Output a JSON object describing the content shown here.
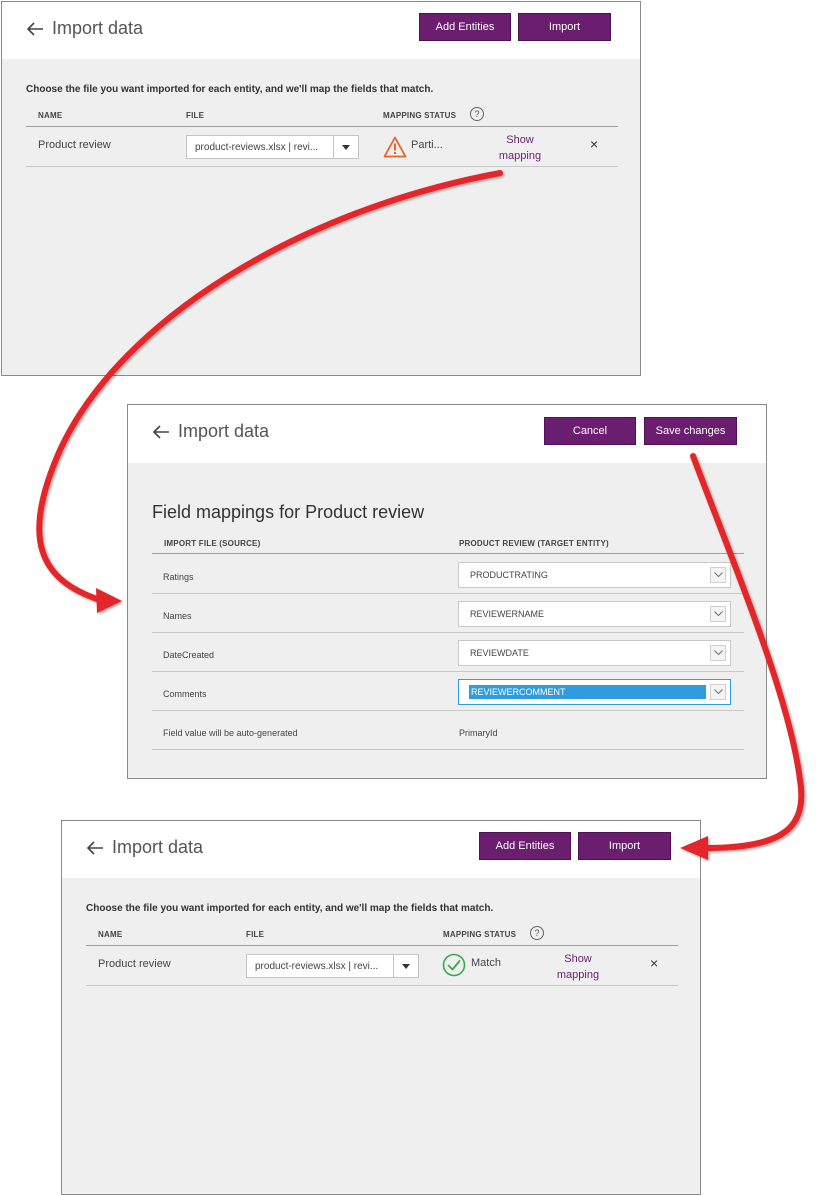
{
  "panel1": {
    "title": "Import data",
    "add_entities_label": "Add Entities",
    "import_label": "Import",
    "intro": "Choose the file you want imported for each entity, and we'll map the fields that match.",
    "columns": {
      "name": "NAME",
      "file": "FILE",
      "status": "MAPPING STATUS"
    },
    "help_glyph": "?",
    "row": {
      "name": "Product review",
      "file": "product-reviews.xlsx | revi...",
      "status_icon": "warning-icon",
      "status": "Parti...",
      "link_line1": "Show",
      "link_line2": "mapping",
      "remove_glyph": "×"
    }
  },
  "panel2": {
    "title": "Import data",
    "cancel_label": "Cancel",
    "save_label": "Save changes",
    "heading": "Field mappings for Product review",
    "columns": {
      "source": "IMPORT FILE (SOURCE)",
      "target": "PRODUCT REVIEW (TARGET ENTITY)"
    },
    "rows": [
      {
        "source": "Ratings",
        "target": "PRODUCTRATING"
      },
      {
        "source": "Names",
        "target": "REVIEWERNAME"
      },
      {
        "source": "DateCreated",
        "target": "REVIEWDATE"
      },
      {
        "source": "Comments",
        "target": "REVIEWERCOMMENT"
      }
    ],
    "auto_label": "Field value will be auto-generated",
    "auto_value": "PrimaryId"
  },
  "panel3": {
    "title": "Import data",
    "add_entities_label": "Add Entities",
    "import_label": "Import",
    "intro": "Choose the file you want imported for each entity, and we'll map the fields that match.",
    "columns": {
      "name": "NAME",
      "file": "FILE",
      "status": "MAPPING STATUS"
    },
    "help_glyph": "?",
    "row": {
      "name": "Product review",
      "file": "product-reviews.xlsx | revi...",
      "status_icon": "check-circle-icon",
      "status": "Match",
      "link_line1": "Show",
      "link_line2": "mapping",
      "remove_glyph": "×"
    }
  },
  "colors": {
    "accent": "#6b1e6f",
    "panel_bg": "#efefef",
    "warning": "#e8632b",
    "success": "#3aa84a",
    "selection": "#2f9be0",
    "annotation_arrow": "#e3262b"
  }
}
